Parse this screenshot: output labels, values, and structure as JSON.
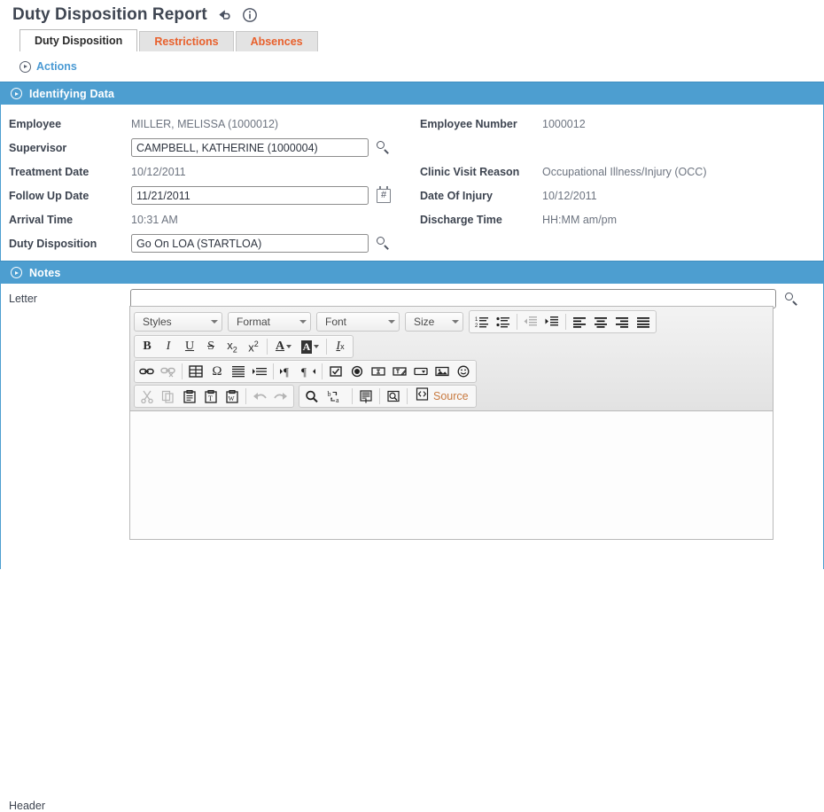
{
  "header": {
    "title": "Duty Disposition Report",
    "icons": [
      {
        "name": "undo-icon",
        "glyph": "undo"
      },
      {
        "name": "info-icon",
        "glyph": "info"
      }
    ]
  },
  "tabs": [
    {
      "label": "Duty Disposition",
      "active": true
    },
    {
      "label": "Restrictions",
      "active": false
    },
    {
      "label": "Absences",
      "active": false
    }
  ],
  "actions": {
    "label": "Actions"
  },
  "sections": {
    "identifying": {
      "title": "Identifying Data"
    },
    "notes": {
      "title": "Notes"
    }
  },
  "identifying_data": {
    "left": [
      {
        "label": "Employee",
        "value": "MILLER, MELISSA (1000012)",
        "type": "readonly"
      },
      {
        "label": "Supervisor",
        "value": "CAMPBELL, KATHERINE (1000004)",
        "type": "input",
        "addon": "search"
      },
      {
        "label": "Treatment Date",
        "value": "10/12/2011",
        "type": "readonly"
      },
      {
        "label": "Follow Up Date",
        "value": "11/21/2011",
        "type": "input",
        "addon": "calendar"
      },
      {
        "label": "Arrival Time",
        "value": "10:31 AM",
        "type": "readonly"
      },
      {
        "label": "Duty Disposition",
        "value": "Go On LOA (STARTLOA)",
        "type": "input",
        "addon": "search"
      }
    ],
    "right": [
      {
        "label": "Employee Number",
        "value": "1000012",
        "type": "readonly"
      },
      {
        "label": "",
        "value": "",
        "type": "spacer"
      },
      {
        "label": "Clinic Visit Reason",
        "value": "Occupational Illness/Injury (OCC)",
        "type": "readonly"
      },
      {
        "label": "Date Of Injury",
        "value": "10/12/2011",
        "type": "readonly"
      },
      {
        "label": "Discharge Time",
        "value": "HH:MM am/pm",
        "type": "readonly"
      },
      {
        "label": "",
        "value": "",
        "type": "spacer"
      }
    ]
  },
  "notes": {
    "letter": {
      "label": "Letter",
      "value": "",
      "placeholder": ""
    },
    "header_field": {
      "label": "Header",
      "value": ""
    }
  },
  "editor": {
    "combos": [
      {
        "label": "Styles",
        "name": "styles-dropdown"
      },
      {
        "label": "Format",
        "name": "format-dropdown"
      },
      {
        "label": "Font",
        "name": "font-dropdown"
      },
      {
        "label": "Size",
        "name": "size-dropdown"
      }
    ],
    "source_label": "Source"
  },
  "colors": {
    "accent_blue": "#4d9ed0",
    "tab_orange": "#e8602c",
    "link_blue": "#4a9ad4",
    "label_gray": "#3d4450",
    "value_gray": "#6d7480",
    "source_orange": "#c87a40"
  }
}
